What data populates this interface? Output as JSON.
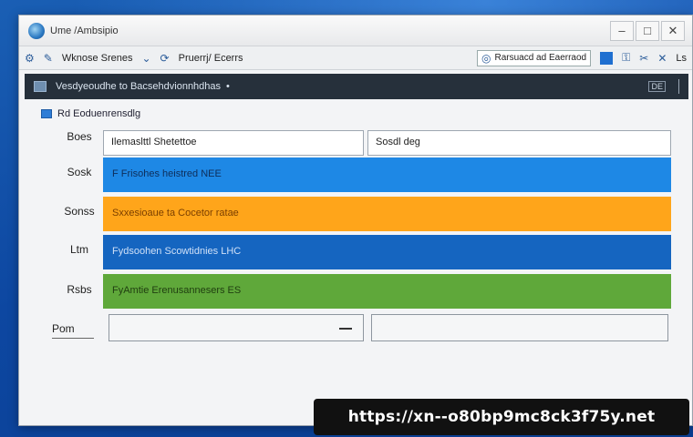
{
  "window": {
    "title": "Ume /Ambsipio",
    "controls": [
      "–",
      "□",
      "✕"
    ]
  },
  "toolbar": {
    "items": [
      "Wknose Srenes",
      "Pruerrj/ Ecerrs"
    ],
    "address_text": "Rarsuacd ad Eaerraod",
    "right_labels": [
      "Ls"
    ]
  },
  "header": {
    "title": "Vesdyeoudhe to Bacsehdvionnhdhas",
    "mini_label": "DE"
  },
  "section": {
    "title": "Rd Eoduenrensdlg"
  },
  "form": {
    "row1_label": "Boes",
    "row1_field_a": "Ilemaslttl Shetettoe",
    "row1_field_b": "Sosdl deg",
    "rows": [
      {
        "label": "Sosk",
        "text": "F Frisohes heistred NEE"
      },
      {
        "label": "Sonss",
        "text": "Sxxesioaue ta Cocetor ratae"
      },
      {
        "label": "Ltm",
        "text": "Fydsoohen Scowtidnies LHC"
      },
      {
        "label": "Rsbs",
        "text": "FyAmtie Erenusannesers ES"
      }
    ],
    "bottom_label": "Pom"
  },
  "overlay": {
    "url": "https://xn--o80bp9mc8ck3f75y.net"
  },
  "colors": {
    "bar_blue": "#1e88e5",
    "bar_orange": "#ffa51a",
    "bar_dark_blue": "#1565c0",
    "bar_green": "#5fa83a",
    "header_bg": "#26303b"
  }
}
